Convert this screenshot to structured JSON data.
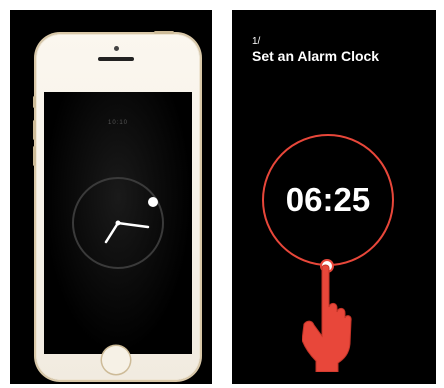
{
  "left_panel": {
    "phone": {
      "screen_time_small": "10:10"
    }
  },
  "right_panel": {
    "step_number": "1/",
    "step_title": "Set an Alarm Clock",
    "alarm_time": "06:25"
  },
  "colors": {
    "accent": "#e8473a",
    "background": "#000000",
    "phone_body": "#f6f1e6",
    "phone_trim": "#cdbb98"
  },
  "icons": [
    "pointing-hand-icon",
    "dial-handle",
    "clock-face"
  ]
}
